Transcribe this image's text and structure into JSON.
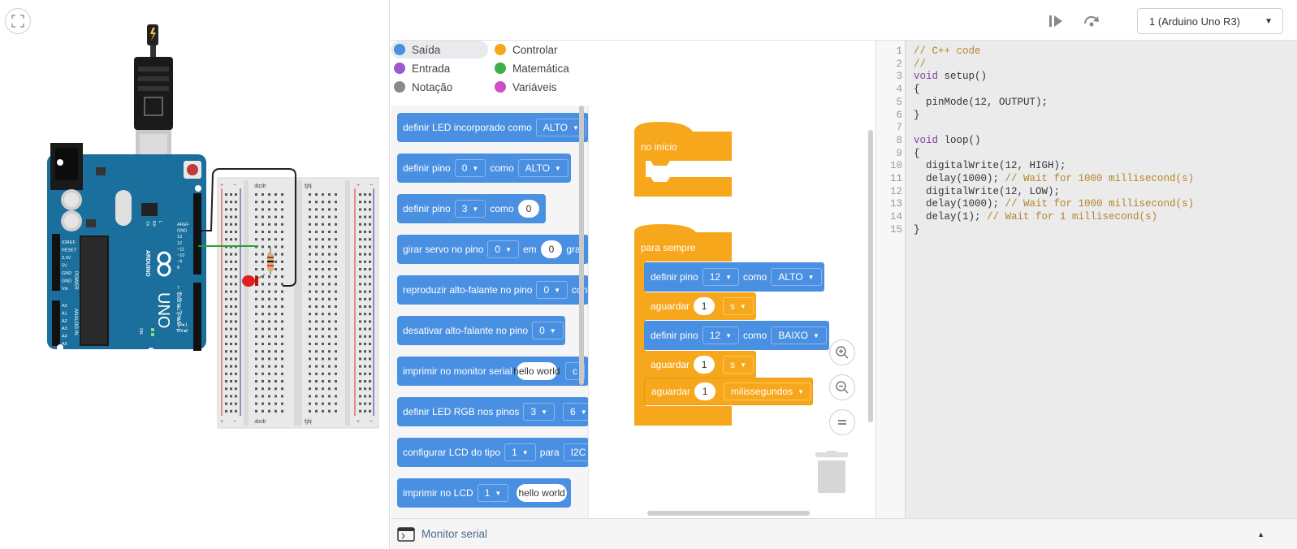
{
  "toolbar": {
    "device_label": "1 (Arduino Uno R3)",
    "play_icon": "step-play-icon",
    "restart_icon": "rotate-icon"
  },
  "categories": [
    {
      "label": "Saída",
      "color": "#4a90e2",
      "selected": true
    },
    {
      "label": "Controlar",
      "color": "#f7a71b"
    },
    {
      "label": "Entrada",
      "color": "#9b59d0"
    },
    {
      "label": "Matemática",
      "color": "#3fae49"
    },
    {
      "label": "Notação",
      "color": "#8a8a8a"
    },
    {
      "label": "Variáveis",
      "color": "#d04ec1"
    }
  ],
  "palette": {
    "b1": {
      "text": "definir LED incorporado como",
      "dd": "ALTO"
    },
    "b2": {
      "t1": "definir pino",
      "dd1": "0",
      "t2": "como",
      "dd2": "ALTO"
    },
    "b3": {
      "t1": "definir pino",
      "dd1": "3",
      "t2": "como",
      "val": "0"
    },
    "b4": {
      "t1": "girar servo no pino",
      "dd1": "0",
      "t2": "em",
      "val": "0",
      "t3": "gra"
    },
    "b5": {
      "t1": "reproduzir alto-falante no pino",
      "dd1": "0",
      "t2": "con"
    },
    "b6": {
      "t1": "desativar alto-falante no pino",
      "dd1": "0"
    },
    "b7": {
      "t1": "imprimir no monitor serial",
      "val": "hello world",
      "t2": "c"
    },
    "b8": {
      "t1": "definir LED RGB nos pinos",
      "dd1": "3",
      "dd2": "6"
    },
    "b9": {
      "t1": "configurar LCD do tipo",
      "dd1": "1",
      "t2": "para",
      "t3": "I2C ("
    },
    "b10": {
      "t1": "imprimir no LCD",
      "dd1": "1",
      "val": "hello world"
    }
  },
  "workspace": {
    "start_label": "no início",
    "forever_label": "para sempre",
    "s1": {
      "t1": "definir pino",
      "dd1": "12",
      "t2": "como",
      "dd2": "ALTO"
    },
    "s2": {
      "t1": "aguardar",
      "val": "1",
      "dd": "s"
    },
    "s3": {
      "t1": "definir pino",
      "dd1": "12",
      "t2": "como",
      "dd2": "BAIXO"
    },
    "s4": {
      "t1": "aguardar",
      "val": "1",
      "dd": "s"
    },
    "s5": {
      "t1": "aguardar",
      "val": "1",
      "dd": "milissegundos"
    }
  },
  "code": {
    "lines": [
      "// C++ code",
      "//",
      "void setup()",
      "{",
      "  pinMode(12, OUTPUT);",
      "}",
      "",
      "void loop()",
      "{",
      "  digitalWrite(12, HIGH);",
      "  delay(1000); // Wait for 1000 millisecond(s)",
      "  digitalWrite(12, LOW);",
      "  delay(1000); // Wait for 1000 millisecond(s)",
      "  delay(1); // Wait for 1 millisecond(s)",
      "}"
    ],
    "line_numbers": [
      "1",
      "2",
      "3",
      "4",
      "5",
      "6",
      "7",
      "8",
      "9",
      "10",
      "11",
      "12",
      "13",
      "14",
      "15"
    ]
  },
  "serial": {
    "label": "Monitor serial"
  },
  "board": {
    "labels": [
      "AREF",
      "GND",
      "13",
      "12",
      "~11",
      "~10",
      "~9",
      "8",
      "7",
      "~6",
      "~5",
      "4",
      "~3",
      "2",
      "TX▸1",
      "RX◂0"
    ],
    "power": [
      "IOREF",
      "RESET",
      "3.3V",
      "5V",
      "GND",
      "GND",
      "Vin"
    ],
    "analog": [
      "A0",
      "A1",
      "A2",
      "A3",
      "A4",
      "A5"
    ],
    "uno": "UNO",
    "arduino": "ARDUINO",
    "digital": "DIGITAL (PWM~)",
    "power_title": "POWER",
    "analog_title": "ANALOG IN",
    "on": "ON",
    "tx": "TX",
    "rx": "RX",
    "l": "L"
  },
  "breadboard": {
    "cols_left": "a b c d e",
    "cols_right": "f g h i j",
    "plus": "+",
    "minus": "−"
  }
}
